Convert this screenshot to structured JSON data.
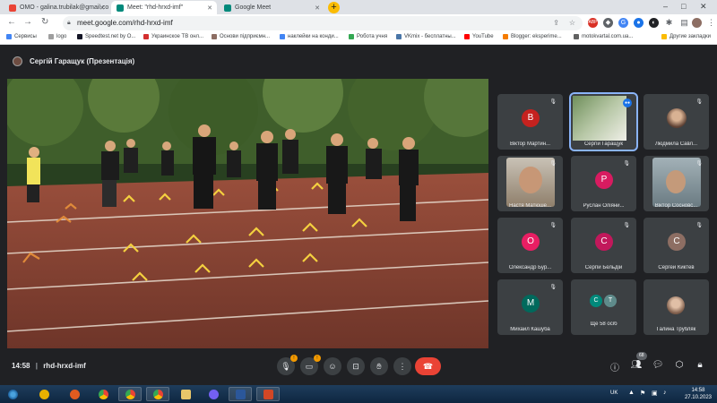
{
  "browser": {
    "tabs": [
      {
        "label": "ОМО - galina.trubilak@gmail.co",
        "color": "#ea4335"
      },
      {
        "label": "Meet: \"rhd-hrxd-imf\"",
        "color": "#00897b"
      },
      {
        "label": "Google Meet",
        "color": "#00897b"
      }
    ],
    "new_tab": "+",
    "url": "meet.google.com/rhd-hrxd-imf"
  },
  "bookmarks": [
    {
      "label": "Сервисы",
      "color": "#4285f4"
    },
    {
      "label": "logo",
      "color": "#9e9e9e"
    },
    {
      "label": "Speedtest.net by O...",
      "color": "#141526"
    },
    {
      "label": "Украинское ТВ онл...",
      "color": "#d32f2f"
    },
    {
      "label": "Основи підприємн...",
      "color": "#8d6e63"
    },
    {
      "label": "наклейки на конди...",
      "color": "#4285f4"
    },
    {
      "label": "Робота учня",
      "color": "#34a853"
    },
    {
      "label": "VKmix - бесплатны...",
      "color": "#4a76a8"
    },
    {
      "label": "YouTube",
      "color": "#ff0000"
    },
    {
      "label": "Blogger: eksperime...",
      "color": "#f57c00"
    },
    {
      "label": "motokvartal.com.ua...",
      "color": "#616161"
    },
    {
      "label": "Другие закладки",
      "color": "#fbbc04"
    }
  ],
  "meet": {
    "presenter": "Сергій Гаращук (Презентація)",
    "time": "14:58",
    "separator": "|",
    "code": "rhd-hrxd-imf",
    "participants_badge": "68",
    "mic_badge": "!",
    "cam_badge": "!",
    "tiles": [
      {
        "name": "Віктор Мартин...",
        "initial": "В",
        "color": "#c5221f",
        "type": "initial"
      },
      {
        "name": "Сергій Гаращук",
        "initial": "",
        "color": "",
        "type": "screen"
      },
      {
        "name": "Людмила Савл...",
        "initial": "",
        "color": "",
        "type": "photo-small"
      },
      {
        "name": "Настя Матюше...",
        "initial": "",
        "color": "",
        "type": "photo"
      },
      {
        "name": "Руслан Оліяни...",
        "initial": "Р",
        "color": "#d81b60",
        "type": "initial"
      },
      {
        "name": "Віктор Сосновс...",
        "initial": "",
        "color": "",
        "type": "photo"
      },
      {
        "name": "Олександр Бур...",
        "initial": "О",
        "color": "#e91e63",
        "type": "initial"
      },
      {
        "name": "Сергій Бельдій",
        "initial": "С",
        "color": "#c2185b",
        "type": "initial"
      },
      {
        "name": "Сергей Киктев",
        "initial": "С",
        "color": "#8d6e63",
        "type": "initial"
      },
      {
        "name": "Михаил Кашуба",
        "initial": "М",
        "color": "#00695c",
        "type": "initial"
      },
      {
        "name": "Ще 58 осіб",
        "initial": "С",
        "color": "#00897b",
        "type": "more",
        "initial2": "Т",
        "color2": "#5f8b8b"
      },
      {
        "name": "Галина Трубляк",
        "initial": "",
        "color": "",
        "type": "photo-small"
      }
    ]
  },
  "taskbar": {
    "lang": "UK",
    "time": "14:58",
    "date": "27.10.2023"
  }
}
